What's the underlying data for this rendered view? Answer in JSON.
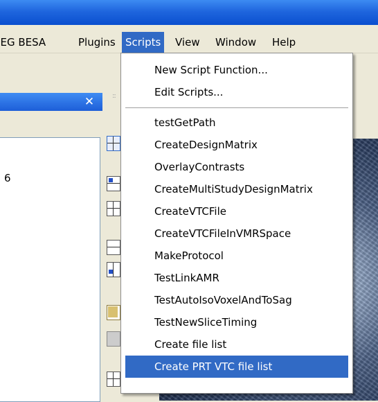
{
  "menubar": {
    "items": [
      {
        "label": "EEG BESA"
      },
      {
        "label": "Plugins"
      },
      {
        "label": "Scripts",
        "active": true
      },
      {
        "label": "View"
      },
      {
        "label": "Window"
      },
      {
        "label": "Help"
      }
    ]
  },
  "panel": {
    "close_glyph": "✕",
    "value": "6"
  },
  "scripts_menu": {
    "top_items": [
      "New Script Function...",
      "Edit Scripts..."
    ],
    "script_items": [
      "testGetPath",
      "CreateDesignMatrix",
      "OverlayContrasts",
      "CreateMultiStudyDesignMatrix",
      "CreateVTCFile",
      "CreateVTCFileInVMRSpace",
      "MakeProtocol",
      "TestLinkAMR",
      "TestAutoIsoVoxelAndToSag",
      "TestNewSliceTiming",
      "Create file list",
      "Create PRT VTC file list"
    ],
    "highlighted_index": 11
  },
  "colors": {
    "title_blue": "#1f66de",
    "highlight": "#316ac5",
    "menu_bg": "#ece9d8"
  }
}
